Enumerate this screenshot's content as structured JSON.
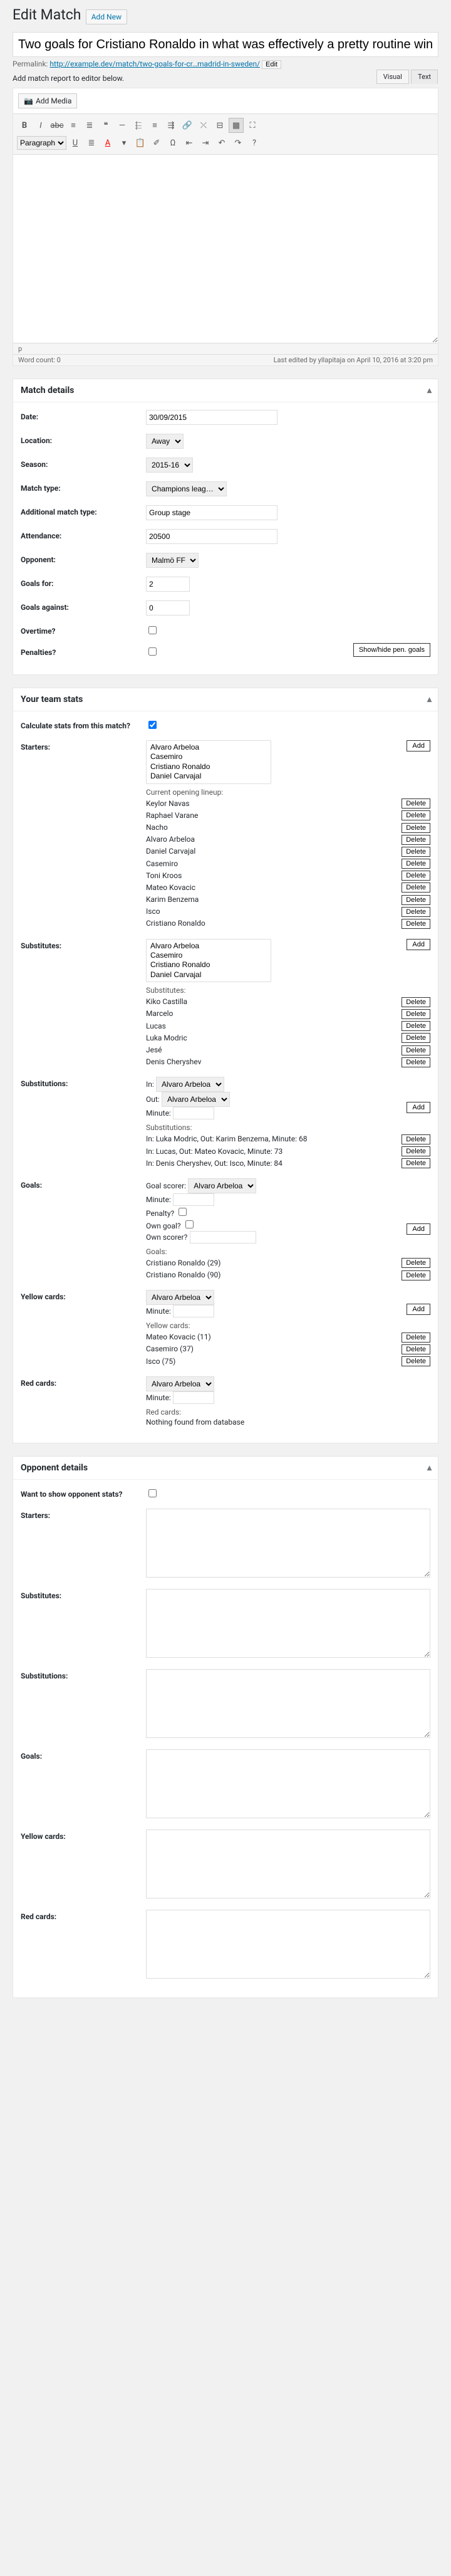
{
  "header": {
    "title": "Edit Match",
    "add_new": "Add New"
  },
  "post": {
    "title": "Two goals for Cristiano Ronaldo in what was effectively a pretty routine win",
    "permalink_label": "Permalink:",
    "permalink_url": "http://example.dev/match/two-goals-for-cr…madrid-in-sweden/",
    "permalink_edit": "Edit",
    "instruction": "Add match report to editor below."
  },
  "editor": {
    "add_media": "Add Media",
    "tabs": {
      "visual": "Visual",
      "text": "Text"
    },
    "paragraph": "Paragraph",
    "path": "p",
    "word_count_label": "Word count:",
    "word_count": "0",
    "last_edited": "Last edited by yllapitaja on April 10, 2016 at 3:20 pm"
  },
  "box_match": {
    "title": "Match details",
    "date_label": "Date:",
    "date": "30/09/2015",
    "location_label": "Location:",
    "location": "Away",
    "season_label": "Season:",
    "season": "2015-16",
    "type_label": "Match type:",
    "type": "Champions leag…",
    "add_type_label": "Additional match type:",
    "add_type": "Group stage",
    "attendance_label": "Attendance:",
    "attendance": "20500",
    "opponent_label": "Opponent:",
    "opponent": "Malmö FF",
    "goals_for_label": "Goals for:",
    "goals_for": "2",
    "goals_against_label": "Goals against:",
    "goals_against": "0",
    "overtime_label": "Overtime?",
    "penalties_label": "Penalties?",
    "pen_btn": "Show/hide pen. goals"
  },
  "box_team": {
    "title": "Your team stats",
    "calc_label": "Calculate stats from this match?",
    "add": "Add",
    "delete": "Delete",
    "starters_label": "Starters:",
    "starters_select": [
      "Alvaro Arbeloa",
      "Casemiro",
      "Cristiano Ronaldo",
      "Daniel Carvajal"
    ],
    "lineup_head": "Current opening lineup:",
    "lineup": [
      "Keylor Navas",
      "Raphael Varane",
      "Nacho",
      "Alvaro Arbeloa",
      "Daniel Carvajal",
      "Casemiro",
      "Toni Kroos",
      "Mateo Kovacic",
      "Karim Benzema",
      "Isco",
      "Cristiano Ronaldo"
    ],
    "subs_label": "Substitutes:",
    "subs_select": [
      "Alvaro Arbeloa",
      "Casemiro",
      "Cristiano Ronaldo",
      "Daniel Carvajal"
    ],
    "subs_head": "Substitutes:",
    "subs": [
      "Kiko Castilla",
      "Marcelo",
      "Lucas",
      "Luka Modric",
      "Jesé",
      "Denis Cheryshev"
    ],
    "substn_label": "Substitutions:",
    "in_label": "In:",
    "out_label": "Out:",
    "minute_label": "Minute:",
    "player_default": "Alvaro Arbeloa",
    "substn_head": "Substitutions:",
    "substns": [
      "In: Luka Modric, Out: Karim Benzema, Minute: 68",
      "In: Lucas, Out: Mateo Kovacic, Minute: 73",
      "In: Denis Cheryshev, Out: Isco, Minute: 84"
    ],
    "goals_label": "Goals:",
    "scorer_label": "Goal scorer:",
    "penalty_q": "Penalty?",
    "own_q": "Own goal?",
    "own_scorer": "Own scorer?",
    "goals_head": "Goals:",
    "goals": [
      "Cristiano Ronaldo (29)",
      "Cristiano Ronaldo (90)"
    ],
    "yellow_label": "Yellow cards:",
    "yellow_head": "Yellow cards:",
    "yellows": [
      "Mateo Kovacic (11)",
      "Casemiro (37)",
      "Isco (75)"
    ],
    "red_label": "Red cards:",
    "red_head": "Red cards:",
    "red_none": "Nothing found from database"
  },
  "box_opp": {
    "title": "Opponent details",
    "show_label": "Want to show opponent stats?",
    "labels": [
      "Starters:",
      "Substitutes:",
      "Substitutions:",
      "Goals:",
      "Yellow cards:",
      "Red cards:"
    ]
  }
}
